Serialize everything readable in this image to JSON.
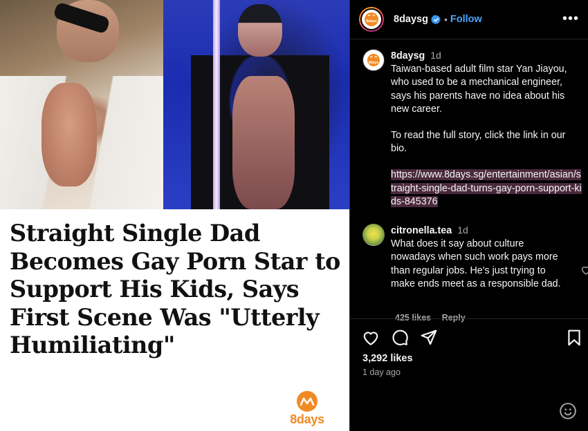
{
  "post": {
    "headline": "Straight Single Dad Becomes Gay Porn Star to Support His Kids, Says First Scene Was \"Utterly Humiliating\"",
    "brand": "8days"
  },
  "header": {
    "avatar_text": "8days",
    "username": "8daysg",
    "separator": "•",
    "follow_label": "Follow",
    "more_label": "•••"
  },
  "caption": {
    "username": "8daysg",
    "time": "1d",
    "paragraph1": "Taiwan-based adult film star Yan Jiayou, who used to be a mechanical engineer, says his parents have no idea about his new career.",
    "paragraph2": "To read the full story, click the link in our bio.",
    "link": "https://www.8days.sg/entertainment/asian/straight-single-dad-turns-gay-porn-support-kids-845376"
  },
  "comment": {
    "username": "citronella.tea",
    "time": "1d",
    "text": "What does it say about culture nowadays when such work pays more than regular jobs. He's just trying to make ends meet as a responsible dad.",
    "likes": "425 likes",
    "reply": "Reply"
  },
  "actions": {
    "icons": [
      "heart-icon",
      "comment-icon",
      "share-icon",
      "bookmark-icon"
    ]
  },
  "stats": {
    "likes": "3,292 likes",
    "posted": "1 day ago"
  },
  "colors": {
    "brand_orange": "#f08a24",
    "follow_blue": "#4ca6ff",
    "link_highlight": "#4a2a3c"
  }
}
